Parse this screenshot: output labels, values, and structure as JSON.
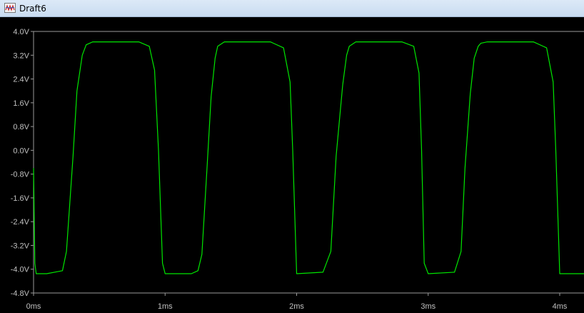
{
  "window": {
    "title": "Draft6",
    "icon": "waveform-app-icon"
  },
  "colors": {
    "background": "#000000",
    "trace": "#00e600",
    "axis": "#9a9a9a",
    "tick_text": "#c0c0c0"
  },
  "chart_data": {
    "type": "line",
    "title": "",
    "xlabel": "",
    "ylabel": "",
    "grid": false,
    "xlim": [
      0,
      4.2
    ],
    "ylim": [
      -4.8,
      4.0
    ],
    "x_ticks": [
      {
        "value": 0,
        "label": "0ms"
      },
      {
        "value": 1,
        "label": "1ms"
      },
      {
        "value": 2,
        "label": "2ms"
      },
      {
        "value": 3,
        "label": "3ms"
      },
      {
        "value": 4,
        "label": "4ms"
      }
    ],
    "y_ticks": [
      {
        "value": 4.0,
        "label": "4.0V"
      },
      {
        "value": 3.2,
        "label": "3.2V"
      },
      {
        "value": 2.4,
        "label": "2.4V"
      },
      {
        "value": 1.6,
        "label": "1.6V"
      },
      {
        "value": 0.8,
        "label": "0.8V"
      },
      {
        "value": 0.0,
        "label": "0.0V"
      },
      {
        "value": -0.8,
        "label": "-0.8V"
      },
      {
        "value": -1.6,
        "label": "-1.6V"
      },
      {
        "value": -2.4,
        "label": "-2.4V"
      },
      {
        "value": -3.2,
        "label": "-3.2V"
      },
      {
        "value": -4.0,
        "label": "-4.0V"
      },
      {
        "value": -4.8,
        "label": "-4.8V"
      }
    ],
    "series": [
      {
        "x": [
          0.0,
          0.01,
          0.02,
          0.1,
          0.22,
          0.25,
          0.3,
          0.33,
          0.37,
          0.4,
          0.45,
          0.5,
          0.8,
          0.88,
          0.92,
          0.95,
          0.98,
          1.0,
          1.2,
          1.25,
          1.28,
          1.32,
          1.35,
          1.38,
          1.4,
          1.45,
          1.5,
          1.8,
          1.9,
          1.95,
          1.97,
          2.0,
          2.2,
          2.26,
          2.3,
          2.35,
          2.38,
          2.4,
          2.45,
          2.5,
          2.8,
          2.89,
          2.93,
          2.95,
          2.97,
          3.0,
          3.2,
          3.25,
          3.28,
          3.32,
          3.35,
          3.38,
          3.4,
          3.45,
          3.5,
          3.8,
          3.9,
          3.95,
          3.97,
          4.0,
          4.2
        ],
        "y": [
          -0.6,
          -3.8,
          -4.15,
          -4.15,
          -4.05,
          -3.4,
          -0.2,
          2.0,
          3.2,
          3.55,
          3.65,
          3.65,
          3.65,
          3.5,
          2.7,
          0.0,
          -3.8,
          -4.15,
          -4.15,
          -4.05,
          -3.5,
          -0.5,
          1.8,
          3.1,
          3.5,
          3.65,
          3.65,
          3.65,
          3.45,
          2.3,
          0.0,
          -4.15,
          -4.1,
          -3.4,
          -0.2,
          2.2,
          3.2,
          3.5,
          3.65,
          3.65,
          3.65,
          3.5,
          2.6,
          0.0,
          -3.8,
          -4.15,
          -4.1,
          -3.4,
          -0.6,
          1.9,
          3.1,
          3.5,
          3.6,
          3.65,
          3.65,
          3.65,
          3.45,
          2.3,
          0.0,
          -4.15,
          -4.15
        ]
      }
    ]
  }
}
